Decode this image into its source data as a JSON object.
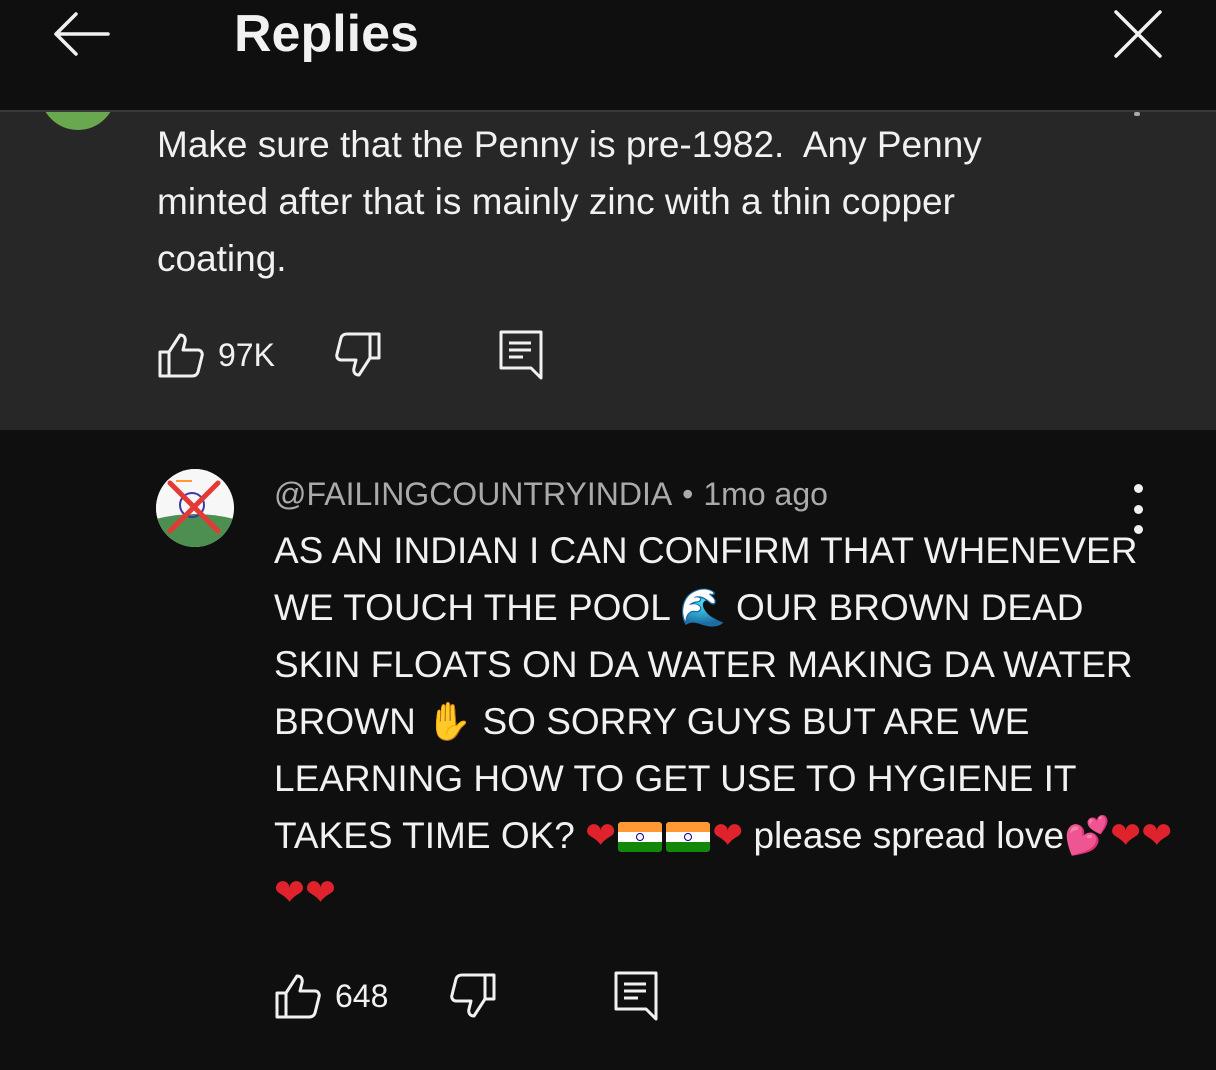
{
  "header": {
    "title": "Replies",
    "back_icon": "arrow-left-icon",
    "close_icon": "close-icon"
  },
  "parent_comment": {
    "text": "Make sure that the Penny is pre-1982.  Any Penny minted after that is mainly zinc with a thin copper coating.",
    "likes": "97K",
    "avatar_color": "#6aa84f",
    "background": "#272727"
  },
  "reply": {
    "author": "@FAILINGCOUNTRYINDIA",
    "separator": "•",
    "time": "1mo ago",
    "text_parts": {
      "p1": "AS AN INDIAN I CAN CONFIRM THAT WHENEVER WE TOUCH THE POOL ",
      "wave_emoji": "🌊",
      "p2": " OUR BROWN DEAD SKIN FLOATS ON DA WATER MAKING DA WATER BROWN ",
      "hand_emoji": "✋",
      "p3": " SO SORRY GUYS BUT ARE WE LEARNING HOW TO GET USE TO HYGIENE IT TAKES TIME OK? ",
      "heart1": "❤",
      "heart2": "❤",
      "p4": " please spread love",
      "hearts_emoji": "💕",
      "heart3": "❤",
      "heart4": "❤",
      "heart5": "❤",
      "heart6": "❤"
    },
    "likes": "648"
  },
  "colors": {
    "background": "#0f0f0f",
    "text": "#f1f1f1",
    "secondary_text": "#aaaaaa",
    "heart": "#e0222c"
  },
  "icons": {
    "like": "thumbs-up-icon",
    "dislike": "thumbs-down-icon",
    "reply": "reply-comment-icon",
    "menu": "more-vert-icon"
  }
}
